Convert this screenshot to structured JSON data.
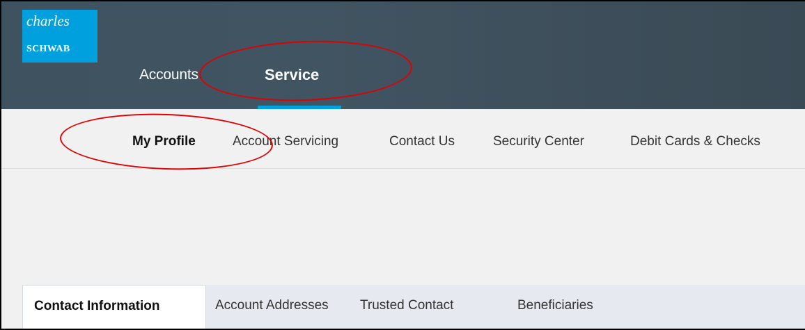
{
  "logo": {
    "line1": "charles",
    "line2": "SCHWAB"
  },
  "top_nav": [
    {
      "label": "Accounts",
      "active": false
    },
    {
      "label": "Service",
      "active": true
    }
  ],
  "sub_nav": [
    {
      "label": "My Profile",
      "active": true
    },
    {
      "label": "Account Servicing",
      "active": false
    },
    {
      "label": "Contact Us",
      "active": false
    },
    {
      "label": "Security Center",
      "active": false
    },
    {
      "label": "Debit Cards & Checks",
      "active": false
    }
  ],
  "content_tabs": [
    {
      "label": "Contact Information",
      "active": true
    },
    {
      "label": "Account Addresses",
      "active": false
    },
    {
      "label": "Trusted Contact",
      "active": false
    },
    {
      "label": "Beneficiaries",
      "active": false
    }
  ],
  "colors": {
    "header_bg": "#415461",
    "brand_blue": "#00a0df",
    "annotation_red": "#e00000"
  }
}
